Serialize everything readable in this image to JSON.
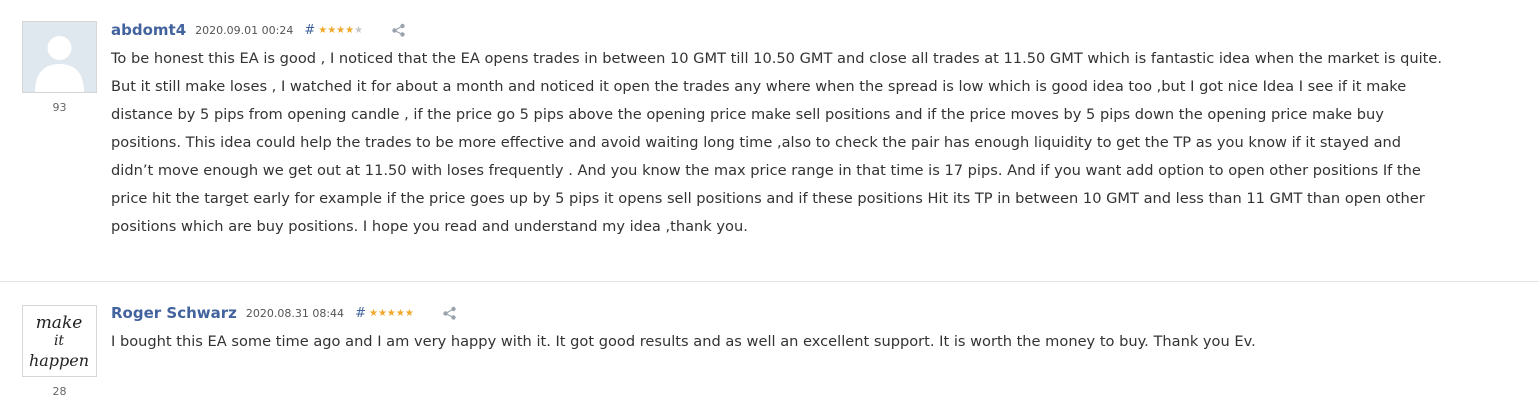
{
  "reviews": [
    {
      "author": "abdomt4",
      "date": "2020.09.01 00:24",
      "hash": "#",
      "rating": 4,
      "rating_count": "93",
      "lines": [
        "To be honest this EA is good , I noticed that the EA opens trades in between 10 GMT till 10.50 GMT and close all trades at 11.50 GMT which is fantastic idea when the market is quite.",
        "But it still make loses , I watched it for about a month and noticed it open the trades any where when the spread is low which is good idea too ,but I got nice Idea I see if it make",
        "distance by 5 pips from opening candle , if the price go 5 pips above the opening price make sell positions and if the price moves by 5 pips down the opening price make buy",
        "positions. This idea could help the trades to be more effective and avoid waiting long time ,also to check the pair has enough liquidity to get the TP as you know if it stayed and",
        "didn’t move enough we get out at 11.50 with loses frequently . And you know the max price range in that time is 17 pips. And if you want add option to open other positions If the",
        "price hit the target early for example if the price goes up by 5 pips it opens sell positions and if these positions Hit its TP in between 10 GMT and less than 11 GMT than open other",
        "positions which are buy positions. I hope you read and understand my idea ,thank you."
      ]
    },
    {
      "author": "Roger Schwarz",
      "date": "2020.08.31 08:44",
      "hash": "#",
      "rating": 5,
      "rating_count": "28",
      "avatar_text": [
        "make",
        "it",
        "happen"
      ],
      "lines": [
        "I bought this EA some time ago and I am very happy with it. It got good results and as well an excellent support. It is worth the money to buy. Thank you Ev."
      ]
    }
  ],
  "colors": {
    "author": "#42639d",
    "star_on": "#f0a92b",
    "star_off": "#c8c8c8",
    "text": "#333333"
  },
  "icons": [
    "default-avatar-icon",
    "share-icon",
    "star-icon"
  ]
}
